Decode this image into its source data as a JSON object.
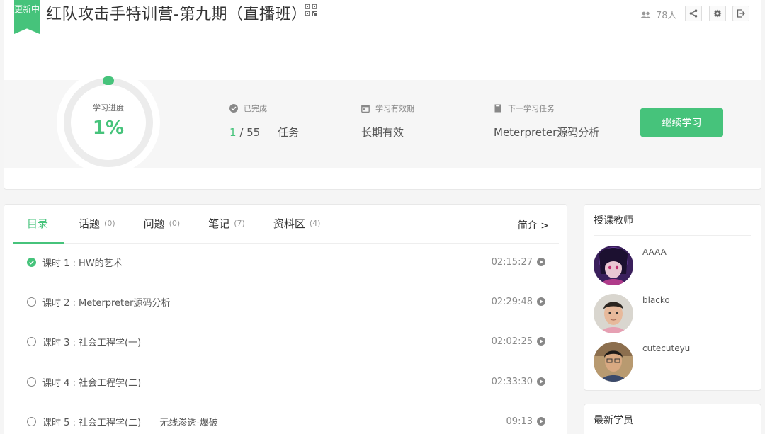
{
  "header": {
    "badge": "更新中",
    "title": "红队攻击手特训营-第九期（直播班）",
    "student_count": "78人"
  },
  "progress": {
    "label": "学习进度",
    "percent_text": "1%",
    "percent": 1
  },
  "stats": {
    "completed": {
      "label": "已完成",
      "done": "1",
      "total": " / 55",
      "unit": "任务"
    },
    "validity": {
      "label": "学习有效期",
      "value": "长期有效"
    },
    "next_task": {
      "label": "下一学习任务",
      "value": "Meterpreter源码分析"
    }
  },
  "continue_button": "继续学习",
  "tabs": [
    {
      "label": "目录",
      "count": ""
    },
    {
      "label": "话题",
      "count": "(0)"
    },
    {
      "label": "问题",
      "count": "(0)"
    },
    {
      "label": "笔记",
      "count": "(7)"
    },
    {
      "label": "资料区",
      "count": "(4)"
    }
  ],
  "intro_link": "简介 >",
  "lessons": [
    {
      "name": "课时 1 : HW的艺术",
      "duration": "02:15:27",
      "status": "completed"
    },
    {
      "name": "课时 2 : Meterpreter源码分析",
      "duration": "02:29:48",
      "status": "pending"
    },
    {
      "name": "课时 3 : 社会工程学(一)",
      "duration": "02:02:25",
      "status": "pending"
    },
    {
      "name": "课时 4 : 社会工程学(二)",
      "duration": "02:33:30",
      "status": "pending"
    },
    {
      "name": "课时 5 : 社会工程学(二)——无线渗透-爆破",
      "duration": "09:13",
      "status": "pending"
    }
  ],
  "teachers_card": {
    "title": "授课教师",
    "teachers": [
      {
        "name": "AAAA"
      },
      {
        "name": "blacko"
      },
      {
        "name": "cutecuteyu"
      }
    ]
  },
  "students_card": {
    "title": "最新学员"
  },
  "colors": {
    "accent": "#46c37b",
    "text": "#333333",
    "muted": "#999999"
  },
  "icons": [
    "qrcode-icon",
    "users-icon",
    "share-icon",
    "gear-icon",
    "exit-icon",
    "check-circle-icon",
    "calendar-icon",
    "book-icon",
    "play-icon"
  ]
}
